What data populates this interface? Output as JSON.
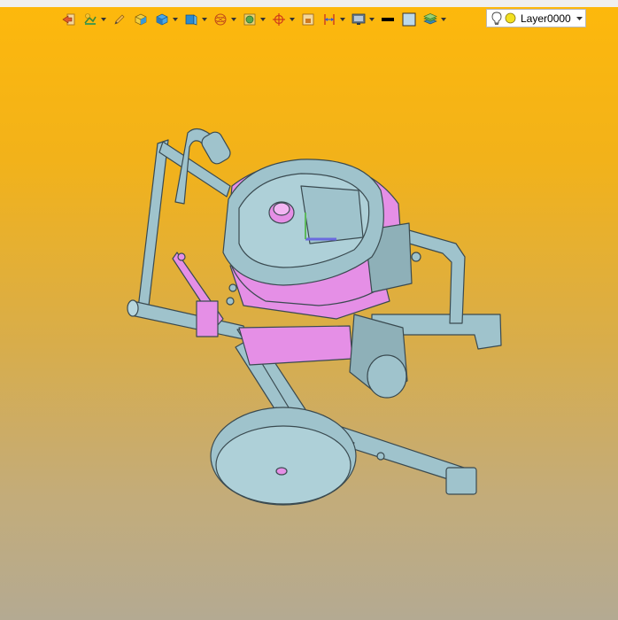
{
  "toolbar": {
    "buttons": [
      {
        "icon": "exit-arrow-icon",
        "has_dropdown": false
      },
      {
        "icon": "sketch-tools-icon",
        "has_dropdown": true
      },
      {
        "icon": "pencil-icon",
        "has_dropdown": false
      },
      {
        "icon": "solid-box-icon",
        "has_dropdown": false
      },
      {
        "icon": "view-cube-icon",
        "has_dropdown": true
      },
      {
        "icon": "shaded-cube-icon",
        "has_dropdown": true
      },
      {
        "icon": "wireframe-sphere-icon",
        "has_dropdown": true
      },
      {
        "icon": "render-style-icon",
        "has_dropdown": true
      },
      {
        "icon": "crosshair-icon",
        "has_dropdown": true
      },
      {
        "icon": "section-box-icon",
        "has_dropdown": false
      },
      {
        "icon": "dimension-icon",
        "has_dropdown": true
      },
      {
        "icon": "display-monitor-icon",
        "has_dropdown": true
      },
      {
        "icon": "line-weight-icon",
        "has_dropdown": false
      },
      {
        "icon": "color-swatch-icon",
        "has_dropdown": false
      },
      {
        "icon": "layers-icon",
        "has_dropdown": true
      }
    ]
  },
  "layer_selector": {
    "value": "Layer0000",
    "visible_icon": "lightbulb-icon",
    "active_icon": "sun-icon"
  },
  "colors": {
    "background_top": "#fdb80c",
    "background_bottom": "#b4aa92",
    "model_primary": "#9fc3cc",
    "model_highlight": "#e58fe6",
    "edge": "#3a4a50"
  }
}
